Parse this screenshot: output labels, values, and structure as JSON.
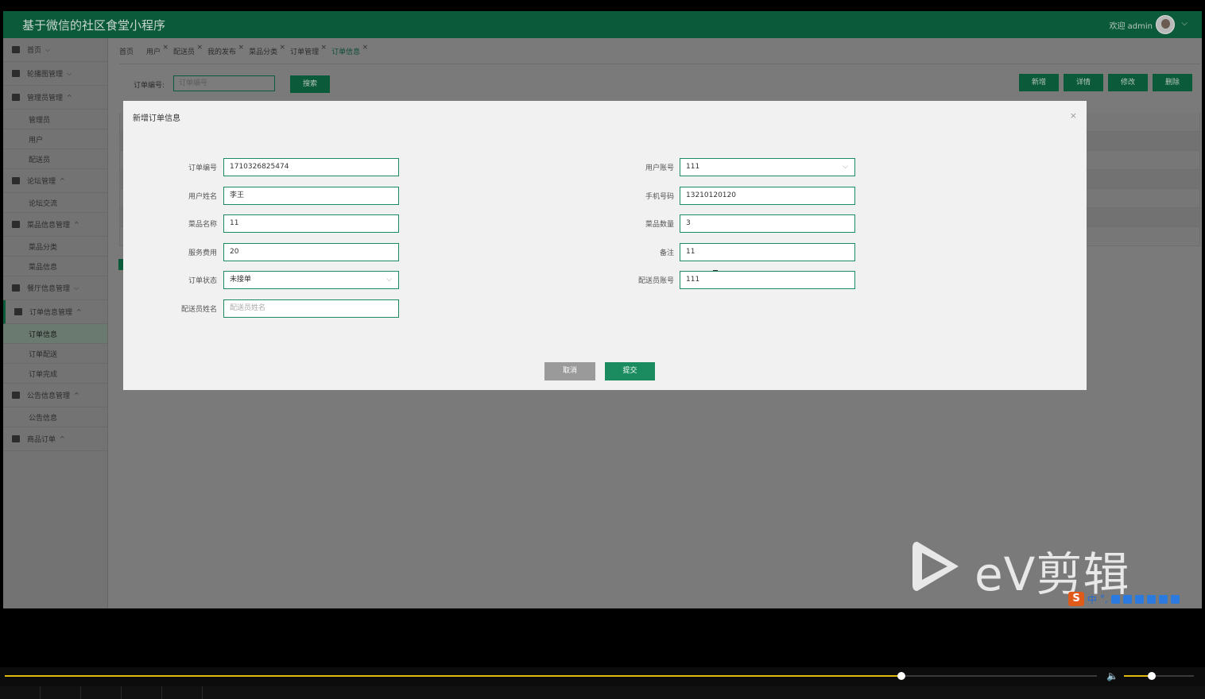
{
  "header": {
    "app_title": "基于微信的社区食堂小程序",
    "welcome": "欢迎 admin",
    "caret": "⌵"
  },
  "sidebar": {
    "items": [
      {
        "label": "首页",
        "type": "group",
        "caret": "⌵"
      },
      {
        "label": "轮播图管理",
        "type": "group",
        "caret": "⌵"
      },
      {
        "label": "管理员管理",
        "type": "group",
        "caret": "^"
      },
      {
        "label": "管理员",
        "type": "sub"
      },
      {
        "label": "用户",
        "type": "sub"
      },
      {
        "label": "配送员",
        "type": "sub"
      },
      {
        "label": "论坛管理",
        "type": "group",
        "caret": "^"
      },
      {
        "label": "论坛交流",
        "type": "sub"
      },
      {
        "label": "菜品信息管理",
        "type": "group",
        "caret": "^"
      },
      {
        "label": "菜品分类",
        "type": "sub"
      },
      {
        "label": "菜品信息",
        "type": "sub"
      },
      {
        "label": "餐厅信息管理",
        "type": "group",
        "caret": "⌵"
      },
      {
        "label": "订单信息管理",
        "type": "group",
        "caret": "^"
      },
      {
        "label": "订单信息",
        "type": "sub"
      },
      {
        "label": "订单配送",
        "type": "sub"
      },
      {
        "label": "订单完成",
        "type": "sub"
      },
      {
        "label": "公告信息管理",
        "type": "group",
        "caret": "^"
      },
      {
        "label": "公告信息",
        "type": "sub"
      },
      {
        "label": "商品订单",
        "type": "group",
        "caret": "^"
      }
    ]
  },
  "tabs": [
    {
      "label": "首页",
      "closable": false
    },
    {
      "label": "用户",
      "closable": true
    },
    {
      "label": "配送员",
      "closable": true
    },
    {
      "label": "我的发布",
      "closable": true
    },
    {
      "label": "菜品分类",
      "closable": true
    },
    {
      "label": "订单管理",
      "closable": true
    },
    {
      "label": "订单信息",
      "closable": true,
      "active": true
    }
  ],
  "tab_close": "×",
  "toolbar": {
    "search_label": "订单编号:",
    "search_placeholder": "订单编号",
    "search_button": "搜索",
    "add_button": "新增",
    "detail_button": "详情",
    "edit_button": "修改",
    "delete_button": "删除"
  },
  "modal": {
    "title": "新增订单信息",
    "close": "×",
    "left_fields": [
      {
        "label": "订单编号",
        "value": "1710326825474"
      },
      {
        "label": "用户姓名",
        "value": "李王"
      },
      {
        "label": "菜品名称",
        "value": "11"
      },
      {
        "label": "服务费用",
        "value": "20"
      },
      {
        "label": "订单状态",
        "value": "未接单",
        "select": true
      },
      {
        "label": "配送员姓名",
        "value": "配送员姓名",
        "placeholder": true
      }
    ],
    "right_fields": [
      {
        "label": "用户账号",
        "value": "111",
        "select": true
      },
      {
        "label": "手机号码",
        "value": "13210120120"
      },
      {
        "label": "菜品数量",
        "value": "3"
      },
      {
        "label": "备注",
        "value": "11"
      },
      {
        "label": "配送员账号",
        "value": "111"
      }
    ],
    "cancel_button": "取消",
    "submit_button": "提交"
  },
  "watermark": {
    "text": "eV剪辑"
  },
  "ime": {
    "logo": "S",
    "lang": "中",
    "punct": "°,"
  },
  "player": {
    "progress": 0.821,
    "volume": 0.4,
    "volume_icon": "🔈"
  }
}
